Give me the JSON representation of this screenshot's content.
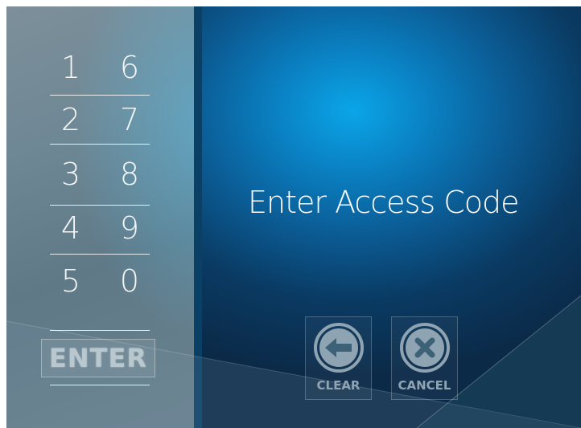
{
  "keypad": {
    "digits": [
      "1",
      "6",
      "2",
      "7",
      "3",
      "8",
      "4",
      "9",
      "5",
      "0"
    ],
    "enter_label": "ENTER"
  },
  "screen": {
    "title": "Enter Access Code"
  },
  "actions": {
    "clear_label": "CLEAR",
    "cancel_label": "CANCEL"
  },
  "icons": {
    "clear": "backspace-arrow-icon",
    "cancel": "x-circle-icon"
  },
  "colors": {
    "accent_blue": "#0aa6e8",
    "keypad_gray": "#6f8895",
    "button_gray": "#8fa4b2"
  }
}
